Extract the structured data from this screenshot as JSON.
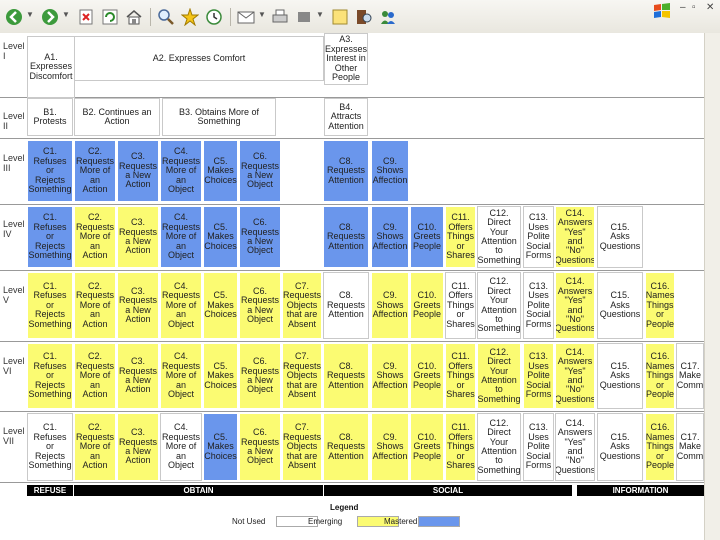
{
  "colors": {
    "not_used": "#ffffff",
    "emerging": "#fbfb72",
    "mastered": "#6a96ec"
  },
  "toolbar": {
    "icons": [
      "back-icon",
      "forward-icon",
      "stop-icon",
      "refresh-icon",
      "home-icon",
      "search-icon",
      "favorites-icon",
      "history-icon",
      "mail-icon",
      "print-icon",
      "edit-icon",
      "discuss-icon",
      "messenger-icon"
    ]
  },
  "levels": [
    "Level\nI",
    "Level\nII",
    "Level\nIII",
    "Level\nIV",
    "Level\nV",
    "Level\nVI",
    "Level\nVII"
  ],
  "cells": [
    {
      "text": "A1.\nExpresses\nDiscomfort",
      "status": "n"
    },
    {
      "text": "A2. Expresses Comfort",
      "status": "n"
    },
    {
      "text": "A3.\nExpresses\nInterest in\nOther\nPeople",
      "status": "n"
    },
    {
      "text": "B1.\nProtests",
      "status": "n"
    },
    {
      "text": "B2. Continues an\nAction",
      "status": "n"
    },
    {
      "text": "B3. Obtains More of\nSomething",
      "status": "n"
    },
    {
      "text": "B4.\nAttracts\nAttention",
      "status": "n"
    },
    {
      "text": "C1.\nRefuses\nor\nRejects\nSomething",
      "status": "m"
    },
    {
      "text": "C2.\nRequests\nMore of\nan\nAction",
      "status": "m"
    },
    {
      "text": "C3.\nRequests\na New\nAction",
      "status": "m"
    },
    {
      "text": "C4.\nRequests\nMore of\nan\nObject",
      "status": "m"
    },
    {
      "text": "C5.\nMakes\nChoices",
      "status": "m"
    },
    {
      "text": "C6.\nRequests\na New\nObject",
      "status": "m"
    },
    {
      "text": "C8.\nRequests\nAttention",
      "status": "m"
    },
    {
      "text": "C9.\nShows\nAffection",
      "status": "m"
    },
    {
      "text": "C1.\nRefuses\nor\nRejects\nSomething",
      "status": "m"
    },
    {
      "text": "C2.\nRequests\nMore of\nan\nAction",
      "status": "e"
    },
    {
      "text": "C3.\nRequests\na New\nAction",
      "status": "e"
    },
    {
      "text": "C4.\nRequests\nMore of\nan\nObject",
      "status": "m"
    },
    {
      "text": "C5.\nMakes\nChoices",
      "status": "m"
    },
    {
      "text": "C6.\nRequests\na New\nObject",
      "status": "m"
    },
    {
      "text": "C8.\nRequests\nAttention",
      "status": "m"
    },
    {
      "text": "C9.\nShows\nAffection",
      "status": "m"
    },
    {
      "text": "C10.\nGreets\nPeople",
      "status": "m"
    },
    {
      "text": "C11.\nOffers\nThings\nor\nShares",
      "status": "e"
    },
    {
      "text": "C12.\nDirect\nYour\nAttention\nto\nSomething",
      "status": "n"
    },
    {
      "text": "C13.\nUses\nPolite\nSocial\nForms",
      "status": "n"
    },
    {
      "text": "C14.\nAnswers\n\"Yes\"\nand\n\"No\"\nQuestions",
      "status": "e"
    },
    {
      "text": "C15.\nAsks\nQuestions",
      "status": "n"
    },
    {
      "text": "C1.\nRefuses\nor\nRejects\nSomething",
      "status": "e"
    },
    {
      "text": "C2.\nRequests\nMore of\nan\nAction",
      "status": "e"
    },
    {
      "text": "C3.\nRequests\na New\nAction",
      "status": "e"
    },
    {
      "text": "C4.\nRequests\nMore of\nan\nObject",
      "status": "e"
    },
    {
      "text": "C5.\nMakes\nChoices",
      "status": "e"
    },
    {
      "text": "C6.\nRequests\na New\nObject",
      "status": "e"
    },
    {
      "text": "C7.\nRequests\nObjects\nthat are\nAbsent",
      "status": "e"
    },
    {
      "text": "C8.\nRequests\nAttention",
      "status": "n"
    },
    {
      "text": "C9.\nShows\nAffection",
      "status": "e"
    },
    {
      "text": "C10.\nGreets\nPeople",
      "status": "e"
    },
    {
      "text": "C11.\nOffers\nThings\nor\nShares",
      "status": "n"
    },
    {
      "text": "C12.\nDirect\nYour\nAttention\nto\nSomething",
      "status": "n"
    },
    {
      "text": "C13.\nUses\nPolite\nSocial\nForms",
      "status": "n"
    },
    {
      "text": "C14.\nAnswers\n\"Yes\"\nand\n\"No\"\nQuestions",
      "status": "e"
    },
    {
      "text": "C15.\nAsks\nQuestions",
      "status": "n"
    },
    {
      "text": "C16.\nNames\nThings\nor\nPeople",
      "status": "e"
    },
    {
      "text": "C1.\nRefuses\nor\nRejects\nSomething",
      "status": "e"
    },
    {
      "text": "C2.\nRequests\nMore of\nan\nAction",
      "status": "e"
    },
    {
      "text": "C3.\nRequests\na New\nAction",
      "status": "e"
    },
    {
      "text": "C4.\nRequests\nMore of\nan\nObject",
      "status": "e"
    },
    {
      "text": "C5.\nMakes\nChoices",
      "status": "e"
    },
    {
      "text": "C6.\nRequests\na New\nObject",
      "status": "e"
    },
    {
      "text": "C7.\nRequests\nObjects\nthat are\nAbsent",
      "status": "e"
    },
    {
      "text": "C8.\nRequests\nAttention",
      "status": "e"
    },
    {
      "text": "C9.\nShows\nAffection",
      "status": "e"
    },
    {
      "text": "C10.\nGreets\nPeople",
      "status": "e"
    },
    {
      "text": "C11.\nOffers\nThings\nor\nShares",
      "status": "e"
    },
    {
      "text": "C12.\nDirect\nYour\nAttention\nto\nSomething",
      "status": "e"
    },
    {
      "text": "C13.\nUses\nPolite\nSocial\nForms",
      "status": "e"
    },
    {
      "text": "C14.\nAnswers\n\"Yes\"\nand\n\"No\"\nQuestions",
      "status": "e"
    },
    {
      "text": "C15.\nAsks\nQuestions",
      "status": "n"
    },
    {
      "text": "C16.\nNames\nThings\nor\nPeople",
      "status": "e"
    },
    {
      "text": "C17.\nMake\nComm",
      "status": "n"
    },
    {
      "text": "C1.\nRefuses\nor\nRejects\nSomething",
      "status": "n"
    },
    {
      "text": "C2.\nRequests\nMore of\nan\nAction",
      "status": "e"
    },
    {
      "text": "C3.\nRequests\na New\nAction",
      "status": "e"
    },
    {
      "text": "C4.\nRequests\nMore of\nan\nObject",
      "status": "n"
    },
    {
      "text": "C5.\nMakes\nChoices",
      "status": "m"
    },
    {
      "text": "C6.\nRequests\na New\nObject",
      "status": "e"
    },
    {
      "text": "C7.\nRequests\nObjects\nthat are\nAbsent",
      "status": "e"
    },
    {
      "text": "C8.\nRequests\nAttention",
      "status": "e"
    },
    {
      "text": "C9.\nShows\nAffection",
      "status": "e"
    },
    {
      "text": "C10.\nGreets\nPeople",
      "status": "e"
    },
    {
      "text": "C11.\nOffers\nThings\nor\nShares",
      "status": "e"
    },
    {
      "text": "C12.\nDirect\nYour\nAttention\nto\nSomething",
      "status": "n"
    },
    {
      "text": "C13.\nUses\nPolite\nSocial\nForms",
      "status": "n"
    },
    {
      "text": "C14.\nAnswers\n\"Yes\"\nand\n\"No\"\nQuestions",
      "status": "n"
    },
    {
      "text": "C15.\nAsks\nQuestions",
      "status": "n"
    },
    {
      "text": "C16.\nNames\nThings\nor\nPeople",
      "status": "e"
    },
    {
      "text": "C17.\nMake\nComm",
      "status": "n"
    }
  ],
  "categories": [
    "REFUSE",
    "OBTAIN",
    "SOCIAL",
    "INFORMATION"
  ],
  "legend": {
    "title": "Legend",
    "not_used": "Not Used",
    "emerging": "Emerging",
    "mastered": "Mastered"
  }
}
